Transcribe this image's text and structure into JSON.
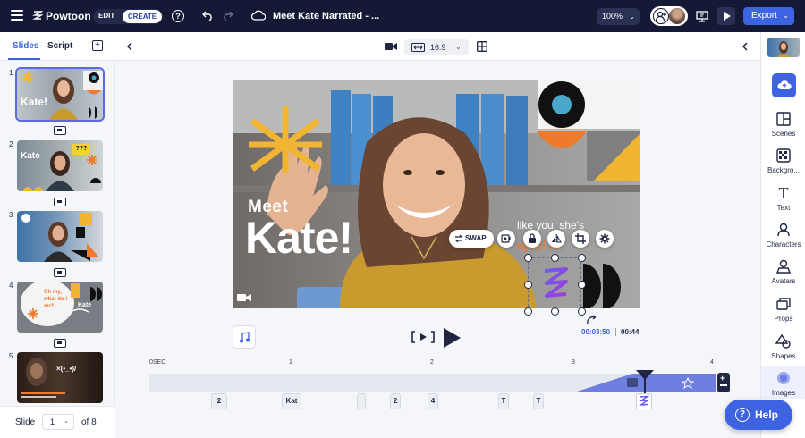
{
  "topbar": {
    "brand": "Powtoon",
    "mode_edit": "EDIT",
    "mode_create": "CREATE",
    "title": "Meet Kate Narrated - ...",
    "zoom": "100%",
    "export_label": "Export",
    "colors": {
      "bar": "#141a36",
      "accent": "#3e63e0"
    }
  },
  "left_panel": {
    "tab_slides": "Slides",
    "tab_script": "Script",
    "slides": [
      {
        "number": "1",
        "text": "Kate!"
      },
      {
        "number": "2",
        "text": "Kate",
        "badge": "???"
      },
      {
        "number": "3",
        "text": ""
      },
      {
        "number": "4",
        "text": "Oh my, what do I do?",
        "name": "Kate"
      },
      {
        "number": "5",
        "text": "×(•_•)/"
      }
    ],
    "footer_label": "Slide",
    "current_slide": "1",
    "total_label": "of 8"
  },
  "canvas": {
    "aspect_ratio": "16:9",
    "slide_title_small": "Meet",
    "slide_title_big": "Kate!",
    "subtitle_text": "like you, she's",
    "swap_label": "SWAP",
    "time_current": "00:03:50",
    "time_total": "00:44"
  },
  "timeline": {
    "ticks": [
      "0SEC",
      "1",
      "2",
      "3",
      "4"
    ],
    "elements": [
      {
        "label": "2"
      },
      {
        "label": "Kat"
      },
      {
        "label": ""
      },
      {
        "label": "2"
      },
      {
        "label": "4"
      },
      {
        "label": "T"
      },
      {
        "label": "T"
      }
    ]
  },
  "right_panel": {
    "items": [
      {
        "label": "Scenes",
        "icon": "scenes-icon"
      },
      {
        "label": "Backgro...",
        "icon": "background-icon"
      },
      {
        "label": "Text",
        "icon": "text-icon"
      },
      {
        "label": "Characters",
        "icon": "characters-icon"
      },
      {
        "label": "Avatars",
        "icon": "avatars-icon"
      },
      {
        "label": "Props",
        "icon": "props-icon"
      },
      {
        "label": "Shapes",
        "icon": "shapes-icon"
      },
      {
        "label": "Images",
        "icon": "images-icon"
      }
    ]
  },
  "help_label": "Help"
}
